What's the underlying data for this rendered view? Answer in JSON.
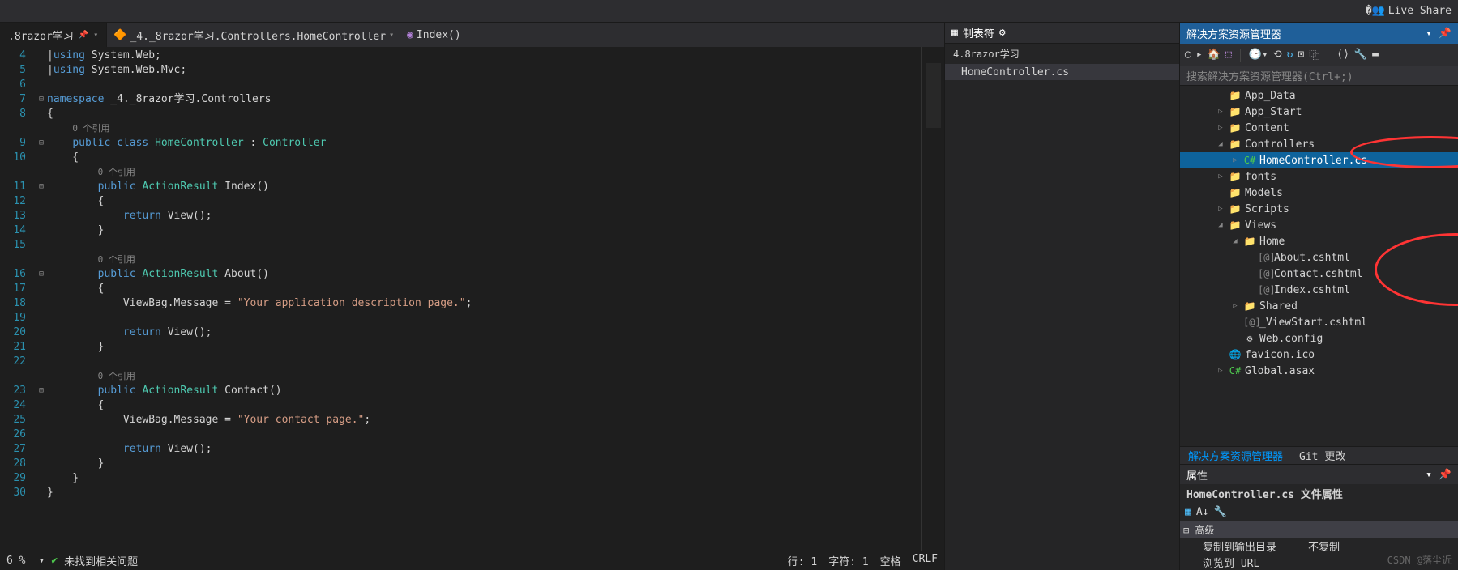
{
  "toolbar": {
    "live_share": "Live Share"
  },
  "tabs": {
    "main": ".8razor学习",
    "crumb1": "_4._8razor学习.Controllers.HomeController",
    "crumb2": "Index()"
  },
  "code_lines": [
    {
      "n": 4,
      "f": "",
      "h": "<span class='pn'>|</span><span class='kw'>using</span> System.Web;"
    },
    {
      "n": 5,
      "f": "",
      "h": "<span class='pn'>|</span><span class='kw'>using</span> System.Web.Mvc;"
    },
    {
      "n": 6,
      "f": "",
      "h": ""
    },
    {
      "n": 7,
      "f": "⊟",
      "h": "<span class='kw'>namespace</span> _4._8razor学习.Controllers"
    },
    {
      "n": 8,
      "f": "",
      "h": "{"
    },
    {
      "n": "",
      "f": "",
      "h": "    <span class='ref'>0 个引用</span>"
    },
    {
      "n": 9,
      "f": "⊟",
      "h": "    <span class='kw'>public</span> <span class='kw'>class</span> <span class='type'>HomeController</span> : <span class='type'>Controller</span>"
    },
    {
      "n": 10,
      "f": "",
      "h": "    {"
    },
    {
      "n": "",
      "f": "",
      "h": "        <span class='ref'>0 个引用</span>"
    },
    {
      "n": 11,
      "f": "⊟",
      "h": "        <span class='kw'>public</span> <span class='type'>ActionResult</span> Index()"
    },
    {
      "n": 12,
      "f": "",
      "h": "        {"
    },
    {
      "n": 13,
      "f": "",
      "h": "            <span class='kw'>return</span> View();"
    },
    {
      "n": 14,
      "f": "",
      "h": "        }"
    },
    {
      "n": 15,
      "f": "",
      "h": ""
    },
    {
      "n": "",
      "f": "",
      "h": "        <span class='ref'>0 个引用</span>"
    },
    {
      "n": 16,
      "f": "⊟",
      "h": "        <span class='kw'>public</span> <span class='type'>ActionResult</span> About()"
    },
    {
      "n": 17,
      "f": "",
      "h": "        {"
    },
    {
      "n": 18,
      "f": "",
      "h": "            ViewBag.Message = <span class='str'>\"Your application description page.\"</span>;"
    },
    {
      "n": 19,
      "f": "",
      "h": ""
    },
    {
      "n": 20,
      "f": "",
      "h": "            <span class='kw'>return</span> View();"
    },
    {
      "n": 21,
      "f": "",
      "h": "        }"
    },
    {
      "n": 22,
      "f": "",
      "h": ""
    },
    {
      "n": "",
      "f": "",
      "h": "        <span class='ref'>0 个引用</span>"
    },
    {
      "n": 23,
      "f": "⊟",
      "h": "        <span class='kw'>public</span> <span class='type'>ActionResult</span> Contact()"
    },
    {
      "n": 24,
      "f": "",
      "h": "        {"
    },
    {
      "n": 25,
      "f": "",
      "h": "            ViewBag.Message = <span class='str'>\"Your contact page.\"</span>;"
    },
    {
      "n": 26,
      "f": "",
      "h": ""
    },
    {
      "n": 27,
      "f": "",
      "h": "            <span class='kw'>return</span> View();"
    },
    {
      "n": 28,
      "f": "",
      "h": "        }"
    },
    {
      "n": 29,
      "f": "",
      "h": "    }"
    },
    {
      "n": 30,
      "f": "",
      "h": "}"
    }
  ],
  "status": {
    "pct": "6 %",
    "issues": "未找到相关问题",
    "line": "行: 1",
    "col": "字符: 1",
    "spc": "空格",
    "enc": "CRLF"
  },
  "mid_panel": {
    "title": "制表符",
    "crumb": "4.8razor学习",
    "file": "HomeController.cs"
  },
  "solution": {
    "title": "解决方案资源管理器",
    "search_placeholder": "搜索解决方案资源管理器(Ctrl+;)",
    "items": [
      {
        "depth": 2,
        "arrow": "",
        "icon": "📁",
        "cls": "folder-icon",
        "label": "App_Data"
      },
      {
        "depth": 2,
        "arrow": "▷",
        "icon": "📁",
        "cls": "folder-icon",
        "label": "App_Start"
      },
      {
        "depth": 2,
        "arrow": "▷",
        "icon": "📁",
        "cls": "folder-icon",
        "label": "Content"
      },
      {
        "depth": 2,
        "arrow": "◢",
        "icon": "📁",
        "cls": "folder-icon",
        "label": "Controllers"
      },
      {
        "depth": 3,
        "arrow": "▷",
        "icon": "C#",
        "cls": "cs-icon",
        "label": "HomeController.cs",
        "selected": true
      },
      {
        "depth": 2,
        "arrow": "▷",
        "icon": "📁",
        "cls": "folder-icon",
        "label": "fonts"
      },
      {
        "depth": 2,
        "arrow": "",
        "icon": "📁",
        "cls": "folder-icon",
        "label": "Models"
      },
      {
        "depth": 2,
        "arrow": "▷",
        "icon": "📁",
        "cls": "folder-icon",
        "label": "Scripts"
      },
      {
        "depth": 2,
        "arrow": "◢",
        "icon": "📁",
        "cls": "folder-icon",
        "label": "Views"
      },
      {
        "depth": 3,
        "arrow": "◢",
        "icon": "📁",
        "cls": "folder-icon",
        "label": "Home"
      },
      {
        "depth": 4,
        "arrow": "",
        "icon": "[@]",
        "cls": "cshtml-icon",
        "label": "About.cshtml"
      },
      {
        "depth": 4,
        "arrow": "",
        "icon": "[@]",
        "cls": "cshtml-icon",
        "label": "Contact.cshtml"
      },
      {
        "depth": 4,
        "arrow": "",
        "icon": "[@]",
        "cls": "cshtml-icon",
        "label": "Index.cshtml"
      },
      {
        "depth": 3,
        "arrow": "▷",
        "icon": "📁",
        "cls": "folder-icon",
        "label": "Shared"
      },
      {
        "depth": 3,
        "arrow": "",
        "icon": "[@]",
        "cls": "cshtml-icon",
        "label": "_ViewStart.cshtml"
      },
      {
        "depth": 3,
        "arrow": "",
        "icon": "⚙",
        "cls": "",
        "label": "Web.config"
      },
      {
        "depth": 2,
        "arrow": "",
        "icon": "🌐",
        "cls": "",
        "label": "favicon.ico"
      },
      {
        "depth": 2,
        "arrow": "▷",
        "icon": "C#",
        "cls": "cs-icon",
        "label": "Global.asax"
      }
    ],
    "tabs": {
      "active": "解决方案资源管理器",
      "other": "Git 更改"
    }
  },
  "props": {
    "title": "属性",
    "sub": "HomeController.cs 文件属性",
    "cat": "⊟ 高级",
    "row1_k": "复制到输出目录",
    "row1_v": "不复制",
    "row2_k": "浏览到 URL"
  },
  "watermark": "CSDN @落尘近"
}
